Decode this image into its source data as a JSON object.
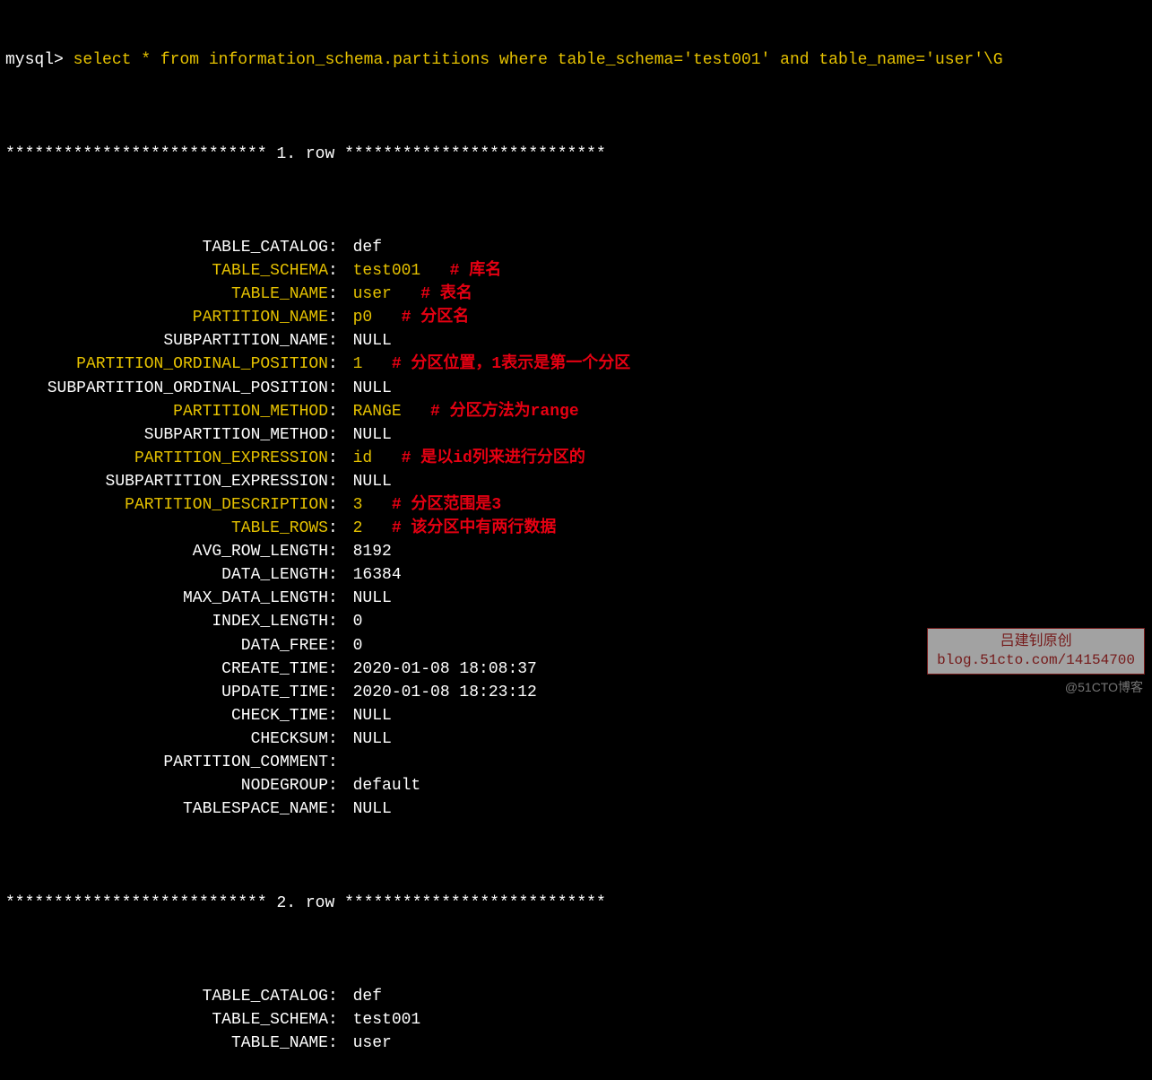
{
  "prompt": "mysql>",
  "sql": "select * from information_schema.partitions where table_schema='test001' and table_name='user'\\G",
  "row1_header_left": "***************************",
  "row1_header_mid": "1. row",
  "row1_header_right": "***************************",
  "rows1": [
    {
      "label": "TABLE_CATALOG",
      "value": "def",
      "hl": false,
      "comment": ""
    },
    {
      "label": "TABLE_SCHEMA",
      "value": "test001",
      "hl": true,
      "comment": "# 库名"
    },
    {
      "label": "TABLE_NAME",
      "value": "user",
      "hl": true,
      "comment": "# 表名"
    },
    {
      "label": "PARTITION_NAME",
      "value": "p0",
      "hl": true,
      "comment": "# 分区名"
    },
    {
      "label": "SUBPARTITION_NAME",
      "value": "NULL",
      "hl": false,
      "comment": ""
    },
    {
      "label": "PARTITION_ORDINAL_POSITION",
      "value": "1",
      "hl": true,
      "comment": "# 分区位置，1表示是第一个分区"
    },
    {
      "label": "SUBPARTITION_ORDINAL_POSITION",
      "value": "NULL",
      "hl": false,
      "comment": ""
    },
    {
      "label": "PARTITION_METHOD",
      "value": "RANGE",
      "hl": true,
      "comment": "# 分区方法为range"
    },
    {
      "label": "SUBPARTITION_METHOD",
      "value": "NULL",
      "hl": false,
      "comment": ""
    },
    {
      "label": "PARTITION_EXPRESSION",
      "value": "id",
      "hl": true,
      "comment": "# 是以id列来进行分区的"
    },
    {
      "label": "SUBPARTITION_EXPRESSION",
      "value": "NULL",
      "hl": false,
      "comment": ""
    },
    {
      "label": "PARTITION_DESCRIPTION",
      "value": "3",
      "hl": true,
      "comment": "# 分区范围是3"
    },
    {
      "label": "TABLE_ROWS",
      "value": "2",
      "hl": true,
      "comment": "# 该分区中有两行数据"
    },
    {
      "label": "AVG_ROW_LENGTH",
      "value": "8192",
      "hl": false,
      "comment": ""
    },
    {
      "label": "DATA_LENGTH",
      "value": "16384",
      "hl": false,
      "comment": ""
    },
    {
      "label": "MAX_DATA_LENGTH",
      "value": "NULL",
      "hl": false,
      "comment": ""
    },
    {
      "label": "INDEX_LENGTH",
      "value": "0",
      "hl": false,
      "comment": ""
    },
    {
      "label": "DATA_FREE",
      "value": "0",
      "hl": false,
      "comment": ""
    },
    {
      "label": "CREATE_TIME",
      "value": "2020-01-08 18:08:37",
      "hl": false,
      "comment": ""
    },
    {
      "label": "UPDATE_TIME",
      "value": "2020-01-08 18:23:12",
      "hl": false,
      "comment": ""
    },
    {
      "label": "CHECK_TIME",
      "value": "NULL",
      "hl": false,
      "comment": ""
    },
    {
      "label": "CHECKSUM",
      "value": "NULL",
      "hl": false,
      "comment": ""
    },
    {
      "label": "PARTITION_COMMENT",
      "value": "",
      "hl": false,
      "comment": ""
    },
    {
      "label": "NODEGROUP",
      "value": "default",
      "hl": false,
      "comment": ""
    },
    {
      "label": "TABLESPACE_NAME",
      "value": "NULL",
      "hl": false,
      "comment": ""
    }
  ],
  "row2_header_left": "***************************",
  "row2_header_mid": "2. row",
  "row2_header_right": "***************************",
  "rows2": [
    {
      "label": "TABLE_CATALOG",
      "value": "def",
      "hl": false,
      "comment": ""
    },
    {
      "label": "TABLE_SCHEMA",
      "value": "test001",
      "hl": false,
      "comment": ""
    },
    {
      "label": "TABLE_NAME",
      "value": "user",
      "hl": false,
      "comment": ""
    }
  ],
  "watermark1_line1": "吕建钊原创",
  "watermark1_line2": "blog.51cto.com/14154700",
  "watermark2": "@51CTO博客"
}
